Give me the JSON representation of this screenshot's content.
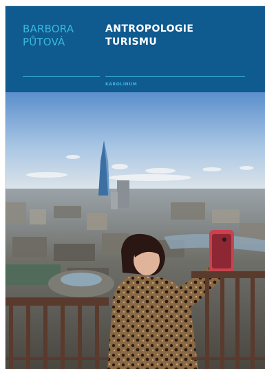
{
  "cover": {
    "author_line1": "BARBORA",
    "author_line2": "PŮTOVÁ",
    "title_line1": "ANTROPOLOGIE",
    "title_line2": "TURISMU",
    "publisher": "KAROLINUM"
  },
  "colors": {
    "header_blue": "#0f5a8f",
    "accent_cyan": "#39b8df",
    "title_white": "#ffffff"
  }
}
